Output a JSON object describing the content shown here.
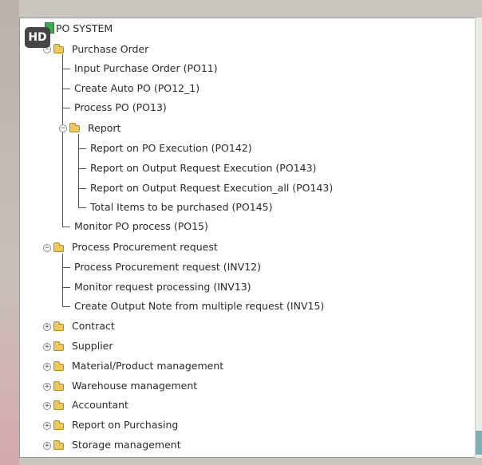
{
  "badge": "HD",
  "tree": {
    "root_label": "PO SYSTEM",
    "purchase_order": {
      "label": "Purchase Order",
      "items": [
        "Input Purchase Order (PO11)",
        "Create Auto PO (PO12_1)",
        "Process PO (PO13)"
      ],
      "report": {
        "label": "Report",
        "items": [
          "Report on PO Execution (PO142)",
          "Report on Output Request Execution (PO143)",
          "Report on Output Request Execution_all (PO143)",
          "Total Items to be purchased (PO145)"
        ]
      },
      "last_item": "Monitor PO process (PO15)"
    },
    "procurement": {
      "label": "Process Procurement request",
      "items": [
        "Process Procurement request (INV12)",
        "Monitor request processing (INV13)",
        "Create Output Note from multiple request (INV15)"
      ]
    },
    "collapsed": [
      "Contract",
      "Supplier",
      "Material/Product management",
      "Warehouse management",
      "Accountant",
      "Report on Purchasing",
      "Storage management"
    ]
  },
  "colors": {
    "folder": "#ecc95a",
    "root_icon": "#3cab4a",
    "scroll_thumb": "#7fb0b8"
  },
  "icons": {
    "root": "root-node-icon",
    "folder": "folder-icon",
    "expanded": "minus-toggle-icon",
    "collapsed": "plus-toggle-icon"
  }
}
